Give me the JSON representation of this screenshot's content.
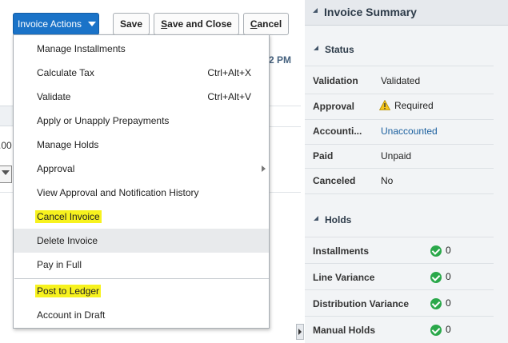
{
  "toolbar": {
    "invoice_actions_label": "Invoice Actions",
    "save_label": "Save",
    "save_close_prefix": "",
    "save_close_mnemonic": "S",
    "save_close_rest": "ave and Close",
    "cancel_mnemonic": "C",
    "cancel_rest": "ancel"
  },
  "background": {
    "partial_time": "2 PM",
    "partial_amount": ".00"
  },
  "menu": {
    "items": [
      {
        "label": "Manage Installments"
      },
      {
        "label": "Calculate Tax",
        "shortcut": "Ctrl+Alt+X"
      },
      {
        "label": "Validate",
        "shortcut": "Ctrl+Alt+V"
      },
      {
        "label": "Apply or Unapply Prepayments"
      },
      {
        "label": "Manage Holds"
      },
      {
        "label": "Approval"
      },
      {
        "label": "View Approval and Notification History"
      },
      {
        "label": "Cancel Invoice"
      },
      {
        "label": "Delete Invoice"
      },
      {
        "label": "Pay in Full"
      },
      {
        "label": "Post to Ledger"
      },
      {
        "label": "Account in Draft"
      }
    ]
  },
  "summary": {
    "title": "Invoice Summary",
    "status": {
      "heading": "Status",
      "rows": [
        {
          "label": "Validation",
          "value": "Validated"
        },
        {
          "label": "Approval",
          "value": "Required"
        },
        {
          "label": "Accounti...",
          "value": "Unaccounted"
        },
        {
          "label": "Paid",
          "value": "Unpaid"
        },
        {
          "label": "Canceled",
          "value": "No"
        }
      ]
    },
    "holds": {
      "heading": "Holds",
      "rows": [
        {
          "label": "Installments",
          "count": "0"
        },
        {
          "label": "Line Variance",
          "count": "0"
        },
        {
          "label": "Distribution Variance",
          "count": "0"
        },
        {
          "label": "Manual Holds",
          "count": "0"
        }
      ]
    }
  },
  "colors": {
    "primary_button": "#1a73c8",
    "highlight": "#f7f21e",
    "link": "#1a5f9e",
    "check_green": "#2aa84a",
    "warning": "#f5c518"
  }
}
